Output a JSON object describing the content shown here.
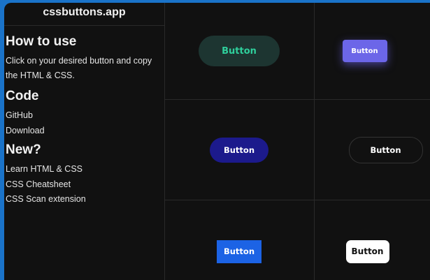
{
  "sidebar": {
    "brand": "cssbuttons.app",
    "how_to_use": {
      "heading": "How to use",
      "text": "Click on your desired button and copy the HTML & CSS."
    },
    "code": {
      "heading": "Code",
      "links": [
        "GitHub",
        "Download"
      ]
    },
    "new": {
      "heading": "New?",
      "links": [
        "Learn HTML & CSS",
        "CSS Cheatsheet",
        "CSS Scan extension"
      ]
    }
  },
  "buttons": [
    {
      "label": "Button"
    },
    {
      "label": "Button"
    },
    {
      "label": "Button"
    },
    {
      "label": "Button"
    },
    {
      "label": "Button"
    },
    {
      "label": "Button"
    }
  ],
  "colors": {
    "page_frame": "#1a73c9",
    "background": "#111111",
    "accent_green": "#2fcf9c",
    "accent_purple": "#6c66e8",
    "accent_navy": "#1c1a8c",
    "accent_blue": "#1c63e5"
  }
}
